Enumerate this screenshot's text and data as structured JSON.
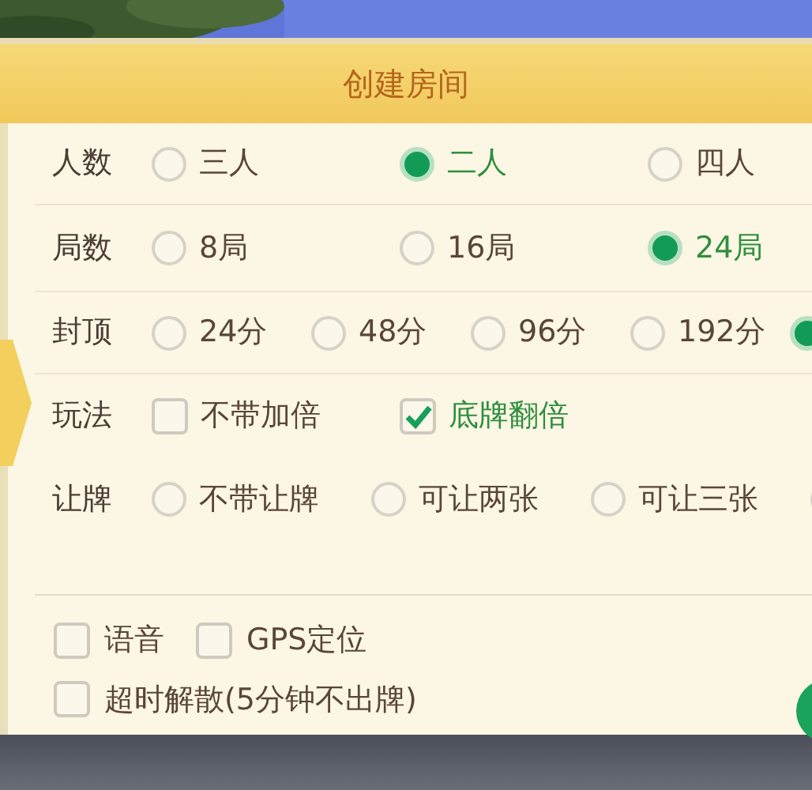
{
  "dialog": {
    "title": "创建房间"
  },
  "settings": [
    {
      "label": "人数",
      "kind": "radio",
      "options": [
        {
          "label": "三人",
          "selected": false
        },
        {
          "label": "二人",
          "selected": true
        },
        {
          "label": "四人",
          "selected": false
        }
      ]
    },
    {
      "label": "局数",
      "kind": "radio",
      "options": [
        {
          "label": "8局",
          "selected": false
        },
        {
          "label": "16局",
          "selected": false
        },
        {
          "label": "24局",
          "selected": true
        }
      ]
    },
    {
      "label": "封顶",
      "kind": "radio",
      "options": [
        {
          "label": "24分",
          "selected": false
        },
        {
          "label": "48分",
          "selected": false
        },
        {
          "label": "96分",
          "selected": false
        },
        {
          "label": "192分",
          "selected": false
        },
        {
          "selected": true
        }
      ]
    },
    {
      "label": "玩法",
      "kind": "checkbox",
      "options": [
        {
          "label": "不带加倍",
          "checked": false
        },
        {
          "label": "底牌翻倍",
          "checked": true
        }
      ]
    },
    {
      "label": "让牌",
      "kind": "radio",
      "options": [
        {
          "label": "不带让牌",
          "selected": false
        },
        {
          "label": "可让两张",
          "selected": false
        },
        {
          "label": "可让三张",
          "selected": false
        },
        {
          "selected": false
        }
      ]
    }
  ],
  "footer_options": [
    {
      "label": "语音",
      "checked": false
    },
    {
      "label": "GPS定位",
      "checked": false
    },
    {
      "label": "超时解散(5分钟不出牌)",
      "checked": false
    }
  ]
}
